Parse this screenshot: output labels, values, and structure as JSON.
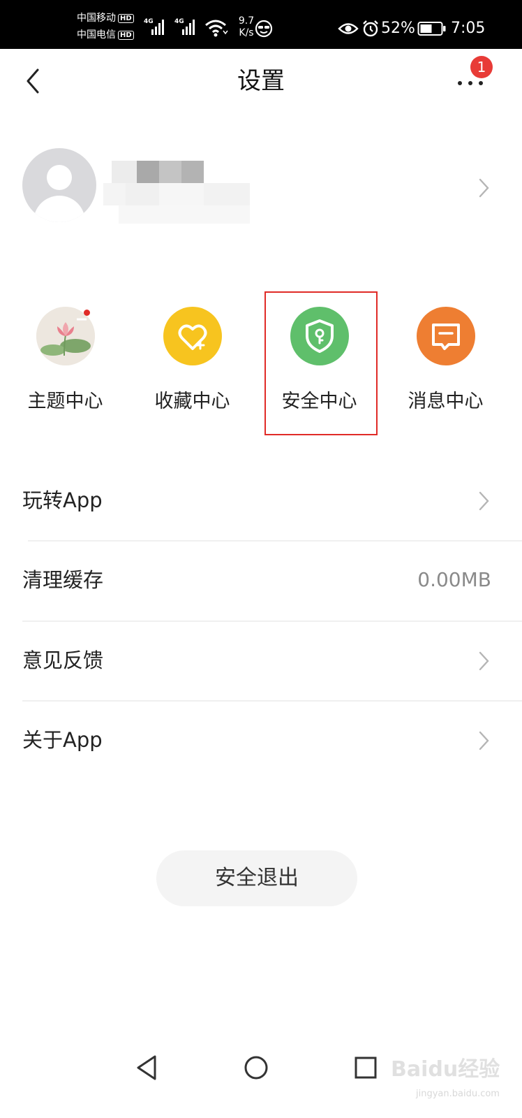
{
  "status_bar": {
    "carrier_1": "中国移动",
    "carrier_2": "中国电信",
    "hd_label": "HD",
    "network_type": "4G",
    "net_speed_value": "9.7",
    "net_speed_unit": "K/s",
    "battery_percent": "52%",
    "time": "7:05"
  },
  "header": {
    "title": "设置",
    "more_badge_count": "1"
  },
  "quick_actions": [
    {
      "label": "主题中心",
      "icon": "theme-lotus-icon",
      "color": "#e9e4dc",
      "has_dot": true
    },
    {
      "label": "收藏中心",
      "icon": "heart-icon",
      "color": "#f7c41f"
    },
    {
      "label": "安全中心",
      "icon": "shield-icon",
      "color": "#5fbf6b"
    },
    {
      "label": "消息中心",
      "icon": "message-icon",
      "color": "#ee7e32"
    }
  ],
  "settings_list": [
    {
      "label": "玩转App",
      "value": ""
    },
    {
      "label": "清理缓存",
      "value": "0.00MB"
    },
    {
      "label": "意见反馈",
      "value": ""
    },
    {
      "label": "关于App",
      "value": ""
    }
  ],
  "logout": {
    "label": "安全退出"
  },
  "watermark": {
    "brand": "Baidu经验",
    "url": "jingyan.baidu.com"
  },
  "colors": {
    "highlight_box": "#e02b27",
    "badge": "#e83b37",
    "secondary_text": "#8a8a8a"
  }
}
